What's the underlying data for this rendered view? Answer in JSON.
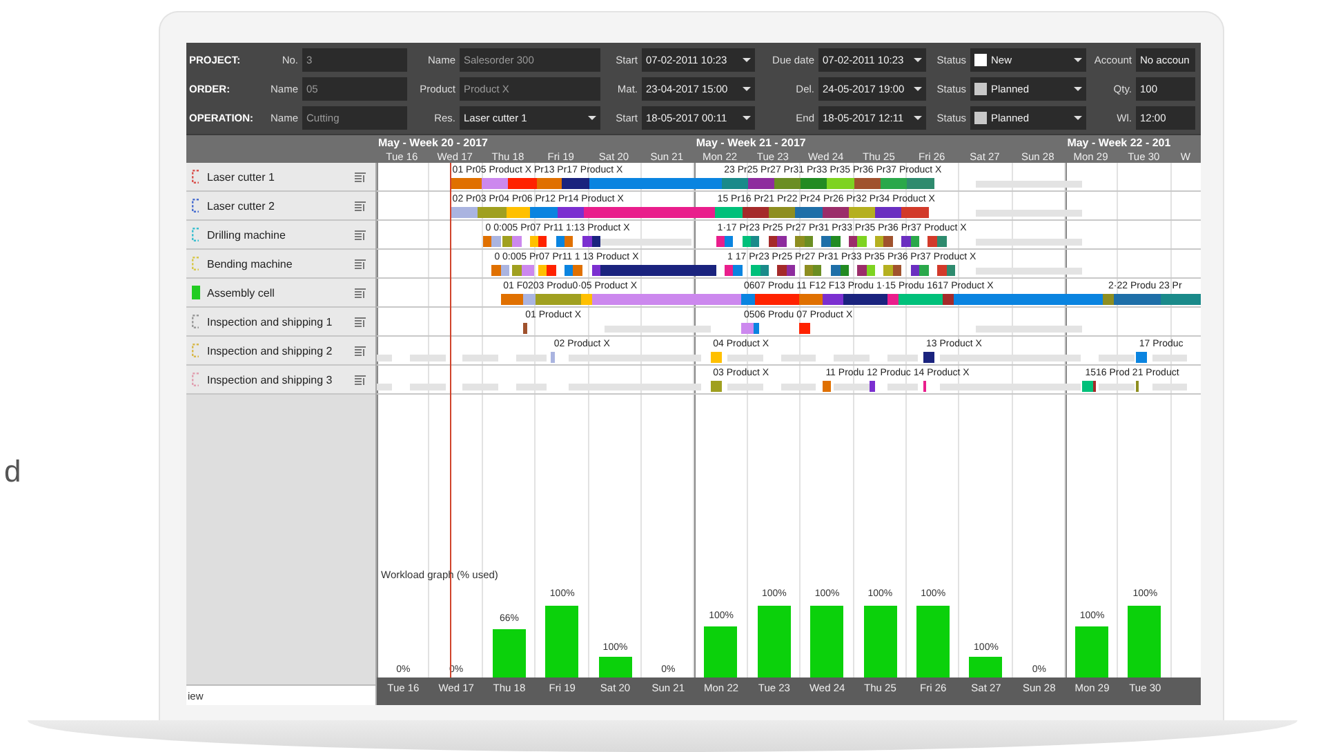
{
  "edge_text": "d",
  "form": {
    "rows": [
      {
        "section": "PROJECT:",
        "fields": [
          {
            "label": "No.",
            "value": "3",
            "kind": "text",
            "editable": false
          },
          {
            "label": "Name",
            "value": "Salesorder 300",
            "kind": "text",
            "editable": false
          },
          {
            "label": "Start",
            "value": "07-02-2011 10:23",
            "kind": "date",
            "editable": true
          },
          {
            "label": "Due date",
            "value": "07-02-2011 10:23",
            "kind": "date",
            "editable": true
          },
          {
            "label": "Status",
            "value": "New",
            "kind": "status",
            "color": "#ffffff",
            "editable": true
          },
          {
            "label": "Account",
            "value": "No accoun",
            "kind": "text",
            "editable": true
          }
        ]
      },
      {
        "section": "ORDER:",
        "fields": [
          {
            "label": "Name",
            "value": "05",
            "kind": "text",
            "editable": false
          },
          {
            "label": "Product",
            "value": "Product X",
            "kind": "text",
            "editable": false
          },
          {
            "label": "Mat.",
            "value": "23-04-2017 15:00",
            "kind": "date",
            "editable": true
          },
          {
            "label": "Del.",
            "value": "24-05-2017 19:00",
            "kind": "date",
            "editable": true
          },
          {
            "label": "Status",
            "value": "Planned",
            "kind": "status",
            "color": "#c8c8c8",
            "editable": true
          },
          {
            "label": "Qty.",
            "value": "100",
            "kind": "text",
            "editable": true
          }
        ]
      },
      {
        "section": "OPERATION:",
        "fields": [
          {
            "label": "Name",
            "value": "Cutting",
            "kind": "text",
            "editable": false
          },
          {
            "label": "Res.",
            "value": "Laser cutter 1",
            "kind": "select",
            "editable": true
          },
          {
            "label": "Start",
            "value": "18-05-2017 00:11",
            "kind": "date",
            "editable": true
          },
          {
            "label": "End",
            "value": "18-05-2017 12:11",
            "kind": "date",
            "editable": true
          },
          {
            "label": "Status",
            "value": "Planned",
            "kind": "status",
            "color": "#c8c8c8",
            "editable": true
          },
          {
            "label": "Wl.",
            "value": "12:00",
            "kind": "text",
            "editable": true
          }
        ]
      }
    ]
  },
  "timeline": {
    "weeks": [
      "May - Week 20 - 2017",
      "May - Week 21 - 2017",
      "May - Week 22 - 201"
    ],
    "days": [
      "Tue 16",
      "Wed 17",
      "Thu 18",
      "Fri 19",
      "Sat 20",
      "Sun 21",
      "Mon 22",
      "Tue 23",
      "Wed 24",
      "Thu 25",
      "Fri 26",
      "Sat 27",
      "Sun 28",
      "Mon 29",
      "Tue 30",
      "W"
    ]
  },
  "resources": [
    {
      "name": "Laser cutter 1",
      "color": "#d9534f",
      "filled": false,
      "labels": [
        "01 Pr05 Product X Pr13 Pr17 Product X",
        "23 Pr25 Pr27 Pr31 Pr33 Pr35 Pr36 Pr37 Product X"
      ]
    },
    {
      "name": "Laser cutter 2",
      "color": "#4a6fd0",
      "filled": false,
      "labels": [
        "02 Pr03 Pr04 Pr06 Pr12 Pr14 Product X",
        "15 Pr16 Pr21 Pr22 Pr24 Pr26 Pr32 Pr34 Product X"
      ]
    },
    {
      "name": "Drilling machine",
      "color": "#3bbfcf",
      "filled": false,
      "labels": [
        "0 0:005 Pr07 Pr11 1:13 Product X",
        "1·17 Pr23 Pr25 Pr27 Pr31 Pr33 Pr35 Pr36 Pr37 Product X"
      ]
    },
    {
      "name": "Bending machine",
      "color": "#d8c84a",
      "filled": false,
      "labels": [
        "0 0:005 Pr07 Pr11 1 13 Product X",
        "1 17 Pr23 Pr25 Pr27 Pr31 Pr33 Pr35 Pr36 Pr37 Product X"
      ]
    },
    {
      "name": "Assembly cell",
      "color": "#22cc22",
      "filled": true,
      "labels": [
        "01 F0203 Produ0·05 Product X",
        "0607 Produ 11 F12 F13 Produ 1·15 Produ 1617 Product X",
        "2·22 Produ 23 Pr"
      ]
    },
    {
      "name": "Inspection and shipping 1",
      "color": "#999999",
      "filled": false,
      "labels": [
        "01 Product X",
        "0506 Produ 07 Product X"
      ]
    },
    {
      "name": "Inspection and shipping 2",
      "color": "#d8b84a",
      "filled": false,
      "labels": [
        "02 Product X",
        "04 Product X",
        "13 Product X",
        "17 Produc"
      ]
    },
    {
      "name": "Inspection and shipping 3",
      "color": "#e0a0b0",
      "filled": false,
      "labels": [
        "03 Product X",
        "11 Produ 12 Produc 14 Product X",
        "1516 Prod 21 Product"
      ]
    }
  ],
  "workload": {
    "title": "Workload graph (% used)",
    "days": [
      {
        "day": "Tue 16",
        "value_label": "0%",
        "level": 0
      },
      {
        "day": "Wed 17",
        "value_label": "0%",
        "level": 0
      },
      {
        "day": "Thu 18",
        "value_label": "66%",
        "level": 0.18
      },
      {
        "day": "Fri 19",
        "value_label": "100%",
        "level": 0.27
      },
      {
        "day": "Sat 20",
        "value_label": "100%",
        "level": 0.08
      },
      {
        "day": "Sun 21",
        "value_label": "0%",
        "level": 0
      },
      {
        "day": "Mon 22",
        "value_label": "100%",
        "level": 0.19
      },
      {
        "day": "Tue 23",
        "value_label": "100%",
        "level": 0.27
      },
      {
        "day": "Wed 24",
        "value_label": "100%",
        "level": 0.27
      },
      {
        "day": "Thu 25",
        "value_label": "100%",
        "level": 0.27
      },
      {
        "day": "Fri 26",
        "value_label": "100%",
        "level": 0.27
      },
      {
        "day": "Sat 27",
        "value_label": "100%",
        "level": 0.08
      },
      {
        "day": "Sun 28",
        "value_label": "0%",
        "level": 0
      },
      {
        "day": "Mon 29",
        "value_label": "100%",
        "level": 0.19
      },
      {
        "day": "Tue 30",
        "value_label": "100%",
        "level": 0.27
      }
    ]
  },
  "bottom_label": "iew"
}
